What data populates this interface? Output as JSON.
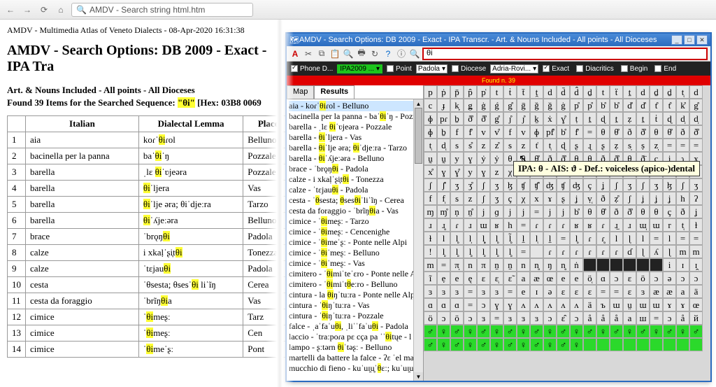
{
  "browser": {
    "url": "AMDV - Search string html.htm"
  },
  "page": {
    "header": "AMDV - Multimedia Atlas of Veneto Dialects - 08-Apr-2020 16:31:38",
    "title": "AMDV - Search Options: DB 2009 - Exact - IPA Tra",
    "sub1": "Art. & Nouns Included - All points - All Dioceses",
    "sub2a": "Found 39 Items for the Searched Sequence: ",
    "sub2b": "\"θi\"",
    "sub2c": " [Hex: 03B8 0069 ",
    "cols": {
      "n": "",
      "it": "Italian",
      "lemma": "Dialectal Lemma",
      "place": "Place"
    },
    "rows": [
      {
        "n": "1",
        "it": "aia",
        "lemma_pre": "koɾˈ",
        "lemma_hl": "θi",
        "lemma_post": "ɾol",
        "place": "Belluno"
      },
      {
        "n": "2",
        "it": "bacinella per la panna",
        "lemma_pre": "baˈ",
        "lemma_hl": "θi",
        "lemma_post": "ˈŋ",
        "place": "Pozzale"
      },
      {
        "n": "3",
        "it": "barella",
        "lemma_pre": "ˌlɛ ",
        "lemma_hl": "θi",
        "lemma_post": "ˈʋjeəra",
        "place": "Pozzale"
      },
      {
        "n": "4",
        "it": "barella",
        "lemma_pre": "",
        "lemma_hl": "θi",
        "lemma_post": "ˈljera",
        "place": "Vas"
      },
      {
        "n": "5",
        "it": "barella",
        "lemma_pre": "",
        "lemma_hl": "θi",
        "lemma_post": "ˈlje ǝra; θiˈdjeːra",
        "place": "Tarzo"
      },
      {
        "n": "6",
        "it": "barella",
        "lemma_pre": "",
        "lemma_hl": "θi",
        "lemma_post": "ˈʎjeːǝra",
        "place": "Belluno"
      },
      {
        "n": "7",
        "it": "brace",
        "lemma_pre": "ˈbrǫŋ",
        "lemma_hl": "θi",
        "lemma_post": "",
        "place": "Padola"
      },
      {
        "n": "8",
        "it": "calze",
        "lemma_pre": "i xkaḷˈʂi̞t",
        "lemma_hl": "θi",
        "lemma_post": "",
        "place": "Tonezza"
      },
      {
        "n": "9",
        "it": "calze",
        "lemma_pre": "ˈtɛjau",
        "lemma_hl": "θi",
        "lemma_post": "",
        "place": "Padola"
      },
      {
        "n": "10",
        "it": "cesta",
        "lemma_pre": "ˈθsesta;  θsesˈ",
        "lemma_hl": "θi",
        "lemma_post": " liˈĩŋ",
        "place": "Cerea"
      },
      {
        "n": "11",
        "it": "cesta da foraggio",
        "lemma_pre": "ˈbrĩŋ",
        "lemma_hl": "θi",
        "lemma_post": "a",
        "place": "Vas"
      },
      {
        "n": "12",
        "it": "cimice",
        "lemma_pre": "ˈ",
        "lemma_hl": "θi",
        "lemma_post": "meʂː",
        "place": "Tarz"
      },
      {
        "n": "13",
        "it": "cimice",
        "lemma_pre": "ˈ",
        "lemma_hl": "θi",
        "lemma_post": "meʂː",
        "place": "Cen"
      },
      {
        "n": "14",
        "it": "cimice",
        "lemma_pre": "ˈ",
        "lemma_hl": "θi",
        "lemma_post": "meˈʂː",
        "place": "Pont"
      }
    ]
  },
  "app": {
    "title": "AMDV - Search Options: DB 2009 - Exact - IPA Transcr. - Art. & Nouns Included - All points - All Dioceses",
    "search_value": "θi",
    "filters": {
      "phone": "Phone D...",
      "db": "IPA2009 ...",
      "point": "Point",
      "point_val": "Padola",
      "diocese": "Diocese",
      "diocese_val": "Adria-Rovi...",
      "exact": "Exact",
      "diacritics": "Diacritics",
      "begin": "Begin",
      "end": "End"
    },
    "found": "Found n. 39",
    "tabs": {
      "map": "Map",
      "results": "Results"
    },
    "tooltip": "IPA: θ - AIS: ϑ - Def.: voiceless (apico-)dental",
    "list": [
      "aia - koɾˈθiɾol - Belluno",
      "bacinella per la panna - baˈθiˈŋ - Pozza",
      "barella - ˌlɛ θiˈʋjeəra - Pozzale",
      "barella - θiˈljera - Vas",
      "barella - θiˈlje ǝra; θiˈdjeːra - Tarzo",
      "barella - θiˈʎjeːǝra - Belluno",
      "brace - ˈbrǫŋθi - Padola",
      "calze - i xkaḷˈʂi̞tθi - Tonezza",
      "calze - ˈtɛjauθi - Padola",
      "cesta - ˈθsesta; θsesθiˈliˈĩŋ - Cerea",
      "cesta da foraggio - ˈbrĩŋθia - Vas",
      "cimice - ˈθimeʂː - Tarzo",
      "cimice - ˈθimeʂː - Cencenighe",
      "cimice - ˈθimeˈʂː - Ponte nelle Alpi",
      "cimice - ˈθiˈmeʂː - Belluno",
      "cimice - ˈθiˈmeʂː - Vas",
      "cimitero - ˈθimiˈteˈɛro - Ponte nelle A",
      "cimitero - ˈθimiˈtθeːro - Belluno",
      "cintura - la θiŋˈtuːra - Ponte nelle Alpi",
      "cintura - ˈθiŋˈtuːra - Vas",
      "cintura - ˈθiŋˈtuːra - Pozzale",
      "falce - ˌaˈfaˈuθi, ˌliˈˈfaˈuθi - Padola",
      "laccio - ˈtraːpoɾa pɛ cça pa ˈˈθitųe - l",
      "lampo - ʂːtǝrn θiˈtǝʂː - Belluno",
      "martelli da battere la falce - ʔɛ ˈel mar",
      "mucchio di fieno - kuˈuɪ̯u̥ˈθɛː; kuˈuɪ̯u"
    ],
    "ipa_rows": [
      [
        "p",
        "ṗ",
        "p̄",
        "p̂",
        "p͑",
        "t",
        "ṫ",
        "t̄",
        "ṱ",
        "d",
        "d̄",
        "d̂",
        "ḏ",
        "t",
        "ẗ",
        "ṯ",
        "d",
        "ḏ",
        "ḏ",
        "t̜",
        "d"
      ],
      [
        "c",
        "ɟ",
        "k̟",
        "ǥ",
        "ġ",
        "ǵ",
        "g̊",
        "ḡ",
        "ğ",
        "ǧ",
        "ġ",
        "p̊",
        "p̊",
        "b̊",
        "b̊",
        "d̊",
        "d̊",
        "t̊",
        "t̊",
        "k̊",
        "g̊"
      ],
      [
        "ɸ",
        "pɾ",
        "ḇ",
        "ð̊",
        "ð̊",
        "g̊",
        "ȷ̊",
        "ȷ̊",
        "ḵ",
        "ẋ",
        "ɣ̊",
        "ṭ",
        "ṯ",
        "ɖ",
        "ṯ",
        "ẓ",
        "ṯ",
        "ṫ",
        "ɖ",
        "d̜",
        "d̜"
      ],
      [
        "ɸ",
        "ḇ",
        "f",
        "f̊",
        "v",
        "v̊",
        "f",
        "v",
        "ɸ",
        "pf̊",
        "b̊",
        "f̊",
        "=",
        "θ",
        "θ̊",
        "ð",
        "ð̊",
        "θ",
        "θ̊",
        "ð",
        "ð̊"
      ],
      [
        "t̜",
        "d̜",
        "s",
        "s̊",
        "z",
        "z̊",
        "s",
        "z",
        "t͑",
        "t̜",
        "ɖ",
        "ʂ",
        "ɻ",
        "ʂ",
        "ẓ",
        "s̩",
        "ṣ",
        "z̩",
        "=",
        "=",
        "="
      ],
      [
        "ṵ",
        "ṵ",
        "y",
        "ɣ",
        "ẏ",
        "ẏ",
        "θ",
        "θ",
        "θ̊",
        "ð",
        "ð̊",
        "θ",
        "θ",
        "ð",
        "ð̊",
        "θ",
        "ð̈",
        "ç",
        "ʝ",
        "ɿ",
        "x"
      ],
      [
        "x̊",
        "ɣ",
        "ɣ̊",
        "y",
        "ɣ",
        "z",
        "χ",
        "ʁ",
        "ʁ",
        "ẖ",
        "",
        "",
        "",
        "",
        "",
        "",
        "",
        "",
        "",
        "",
        ""
      ],
      [
        "ʃ",
        "ʃ̊",
        "ʒ",
        "ʒ̊",
        "ʃ",
        "ʒ",
        "ɮ",
        "ʧ",
        "ʧ̊",
        "ʤ",
        "ʧ",
        "ʤ",
        "ç",
        "ʝ",
        "ʃ",
        "ʒ",
        "ʃ",
        "ʒ",
        "ɮ",
        "ʃ",
        "ʒ"
      ],
      [
        "f",
        "f̜",
        "s",
        "z",
        "ʃ",
        "ʒ",
        "ç",
        "χ",
        "x",
        "ɤ",
        "ʂ",
        "ʝ",
        "ṿ̜",
        "ð",
        "ẓ̊",
        "ʃ",
        "ʝ",
        "ʝ",
        "ʝ",
        "h",
        "ʔ"
      ],
      [
        "ɱ",
        "ɱ̊",
        "ņ",
        "ṉ̊",
        "j",
        "ɡ",
        "j",
        "j",
        "=",
        "j",
        "j",
        "b̊",
        "θ",
        "θ̊",
        "ð",
        "ð̊",
        "θ",
        "θ",
        "ç",
        "ð",
        "ʝ"
      ],
      [
        "ɹ",
        "ɹ̥",
        "ɾ",
        "ɹ",
        "ɯ",
        "ʁ",
        "h",
        "=",
        "ɾ",
        "ɾ",
        "ɾ",
        "ʁ",
        "ʁ",
        "ɾ",
        "ɹ̫",
        "ɹ",
        "ɯ̜",
        "ɯ",
        "r",
        "t̜",
        "ɫ"
      ],
      [
        "ɫ",
        "l",
        "l̥",
        "l̩",
        "l̥̩",
        "l̥",
        "l̥̃",
        "ḻ",
        "l̜",
        "ḻ",
        "=",
        "l̥",
        "ɾ",
        "ɾ̥",
        "l",
        "ɭ",
        "l",
        "=",
        "l",
        "=",
        "="
      ],
      [
        "!",
        "l̥",
        "l̥",
        "l̥",
        "l̥",
        "l̥",
        "l̥",
        "=",
        "",
        "ɾ",
        "ɾ",
        "ɾ",
        "ɾ",
        "ɾ",
        "ɾ",
        "ɗ",
        "ɭ",
        "ʎ",
        "ɭ",
        "m",
        "m"
      ],
      [
        "m",
        "=",
        "π̩",
        "n",
        "π",
        "ṉ",
        "ṉ",
        "n",
        "n̥",
        "ŋ",
        "n̥",
        "ṅ",
        "",
        "",
        "",
        "",
        "",
        "",
        "i",
        "ɪ",
        "ɪ̭"
      ],
      [
        "ĩ",
        "ẹ",
        "e",
        "ę",
        "ε",
        "ε̜",
        "ε̃",
        "a",
        "æ",
        "œ",
        "e",
        "e",
        "ö̜",
        "ɑ",
        "ɔ",
        "ε",
        "ö",
        "ɔ",
        "ə",
        "ɔ",
        "ɔ"
      ],
      [
        "ɜ",
        "ɜ",
        "ɜ",
        "=",
        "ɜ",
        "ɜ",
        "=",
        "e",
        "ɪ",
        "ə",
        "ε",
        "ε",
        "ε",
        "=",
        "=",
        "ε",
        "ɜ",
        "æ",
        "æ",
        "a",
        "ä"
      ],
      [
        "ɑ",
        "ɑ",
        "ɑ",
        "=",
        "ɔ",
        "ɣ",
        "ɣ",
        "ʌ",
        "ʌ",
        "ʌ",
        "ʌ",
        "ʌ",
        "ä",
        "ъ",
        "ɯ",
        "ṳ",
        "ɯ",
        "ɯ",
        "ɤ",
        "ɤ",
        "œ"
      ],
      [
        "ö",
        "ɔ",
        "ö",
        "ɔ",
        "ɜ",
        "=",
        "ɜ",
        "ɜ",
        "ɜ",
        "ɔ",
        "ε̂",
        "ɔ",
        "å",
        "å",
        "å",
        "a",
        "ш",
        "=",
        "ɔ",
        "å",
        "й"
      ],
      [
        "♂",
        "♀",
        "♂",
        "♀",
        "♂",
        "♀",
        "♂",
        "♀",
        "♂",
        "♀",
        "♂",
        "♀",
        "♂",
        "♀",
        "♂",
        "♀",
        "♂",
        "♀",
        "♂",
        "♀",
        "♂"
      ],
      [
        "♂",
        "♀",
        "♂",
        "♀",
        "♂",
        "♀",
        "♂",
        "♀",
        "♂",
        "♀",
        "♂",
        "♀",
        "",
        "",
        "",
        "",
        "",
        "",
        "",
        "",
        ""
      ]
    ]
  }
}
